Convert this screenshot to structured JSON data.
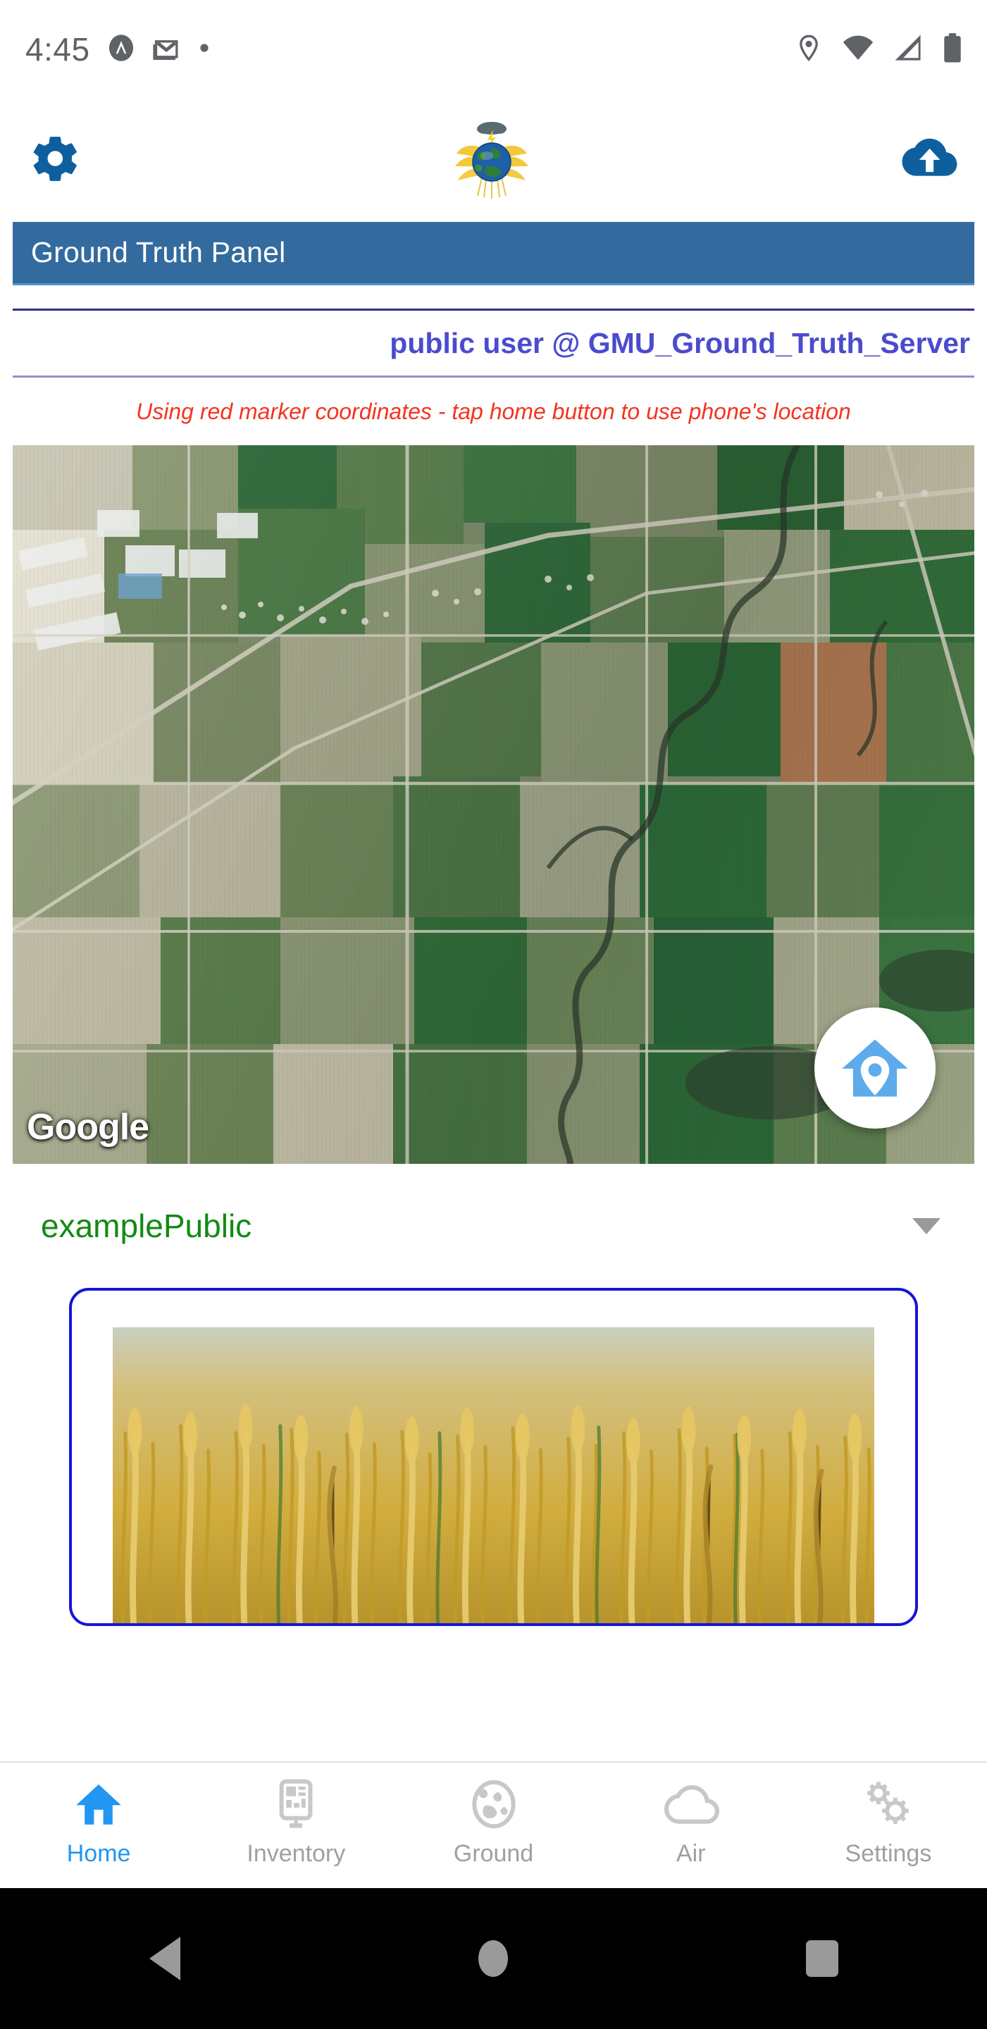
{
  "status_bar": {
    "time": "4:45",
    "left_icons": [
      "assistant-badge-icon",
      "gmail-icon",
      "dot-indicator-icon"
    ],
    "right_icons": [
      "location-pin-icon",
      "wifi-icon",
      "cell-signal-icon",
      "battery-icon"
    ]
  },
  "app_header": {
    "settings_icon": "gear-icon",
    "logo": "globe-wheat-storm-logo",
    "upload_icon": "cloud-upload-icon",
    "accent_color": "#0e5f9e"
  },
  "title_bar": {
    "text": "Ground Truth Panel",
    "background_color": "#336b9e",
    "text_color": "#ffffff"
  },
  "user_row": {
    "text": "public user @ GMU_Ground_Truth_Server",
    "color": "#4b4bcf"
  },
  "hint": {
    "text": "Using red marker coordinates - tap home button to use phone's location",
    "color": "#f4341f"
  },
  "map": {
    "provider_watermark": "Google",
    "marker": "red-map-pin",
    "home_button": "home-location-fab",
    "home_button_color": "#5eabeb"
  },
  "dropdown": {
    "selected": "examplePublic",
    "color": "#138a13",
    "caret": "chevron-down-icon"
  },
  "card": {
    "image": "wheat-field-photo",
    "border_color": "#1414d8"
  },
  "bottom_nav": {
    "active_color": "#2196f3",
    "inactive_color": "#a0a0a0",
    "items": [
      {
        "label": "Home",
        "icon": "home-icon",
        "active": true
      },
      {
        "label": "Inventory",
        "icon": "tablet-device-icon",
        "active": false
      },
      {
        "label": "Ground",
        "icon": "globe-icon",
        "active": false
      },
      {
        "label": "Air",
        "icon": "cloud-icon",
        "active": false
      },
      {
        "label": "Settings",
        "icon": "gears-icon",
        "active": false
      }
    ]
  },
  "android_nav": {
    "back": "back-triangle-icon",
    "home": "home-circle-icon",
    "recents": "recents-square-icon"
  }
}
